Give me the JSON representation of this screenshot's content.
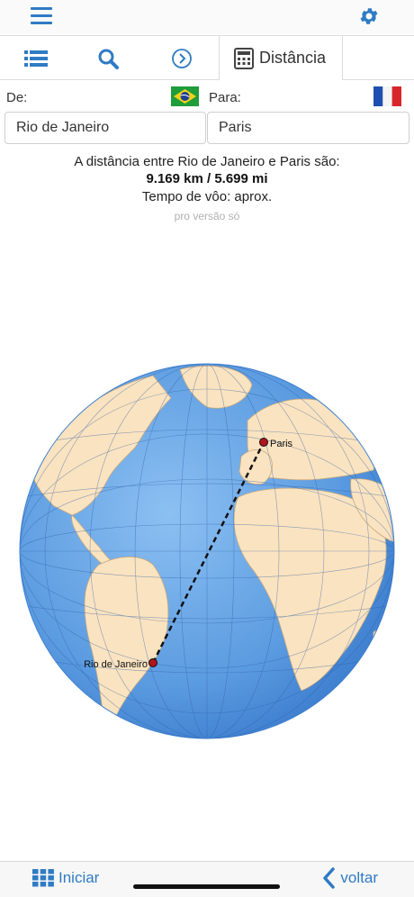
{
  "header": {
    "menu_icon": "hamburger-menu-icon",
    "settings_icon": "gear-icon",
    "accent_color": "#2f7bc4"
  },
  "tabs": {
    "list_icon": "list-icon",
    "search_icon": "search-icon",
    "next_icon": "chevron-right-circle-icon",
    "active": {
      "icon": "calculator-icon",
      "label": "Distância"
    }
  },
  "form": {
    "from_label": "De:",
    "to_label": "Para:",
    "from_value": "Rio de Janeiro",
    "to_value": "Paris",
    "from_flag": "brazil-flag",
    "to_flag": "france-flag"
  },
  "result": {
    "sentence": "A distância entre Rio de Janeiro e Paris são:",
    "distance": "9.169 km / 5.699 mi",
    "flight_time": "Tempo de vôo: aprox.",
    "pro_note": "pro versão só"
  },
  "map": {
    "origin_label": "Rio de Janeiro",
    "destination_label": "Paris",
    "ocean_color": "#5b9be0",
    "land_color": "#fae3c0",
    "marker_color": "#b0141c"
  },
  "footer": {
    "start_label": "Iniciar",
    "back_label": "voltar",
    "start_icon": "grid-icon",
    "back_icon": "chevron-left-icon"
  }
}
